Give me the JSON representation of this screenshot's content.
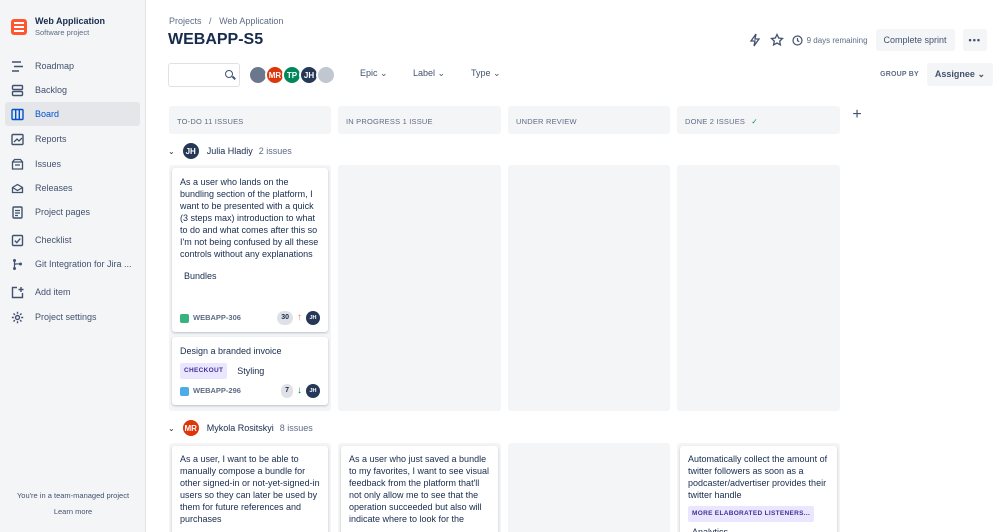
{
  "project": {
    "name": "Web Application",
    "type": "Software project"
  },
  "nav": [
    {
      "label": "Roadmap",
      "icon": "roadmap-icon"
    },
    {
      "label": "Backlog",
      "icon": "backlog-icon"
    },
    {
      "label": "Board",
      "icon": "board-icon",
      "active": true
    },
    {
      "label": "Reports",
      "icon": "reports-icon"
    },
    {
      "label": "Issues",
      "icon": "issues-icon"
    },
    {
      "label": "Releases",
      "icon": "releases-icon"
    },
    {
      "label": "Project pages",
      "icon": "pages-icon"
    },
    {
      "label": "Checklist",
      "icon": "checklist-icon"
    },
    {
      "label": "Git Integration for Jira ...",
      "icon": "git-icon"
    },
    {
      "label": "Add item",
      "icon": "add-item-icon"
    },
    {
      "label": "Project settings",
      "icon": "gear-icon"
    }
  ],
  "footer": {
    "text": "You're in a team-managed project",
    "link": "Learn more"
  },
  "breadcrumbs": {
    "projects": "Projects",
    "sep": "/",
    "current": "Web Application"
  },
  "title": "WEBAPP-S5",
  "header": {
    "days": "9 days remaining",
    "complete": "Complete sprint",
    "more": "•••"
  },
  "toolbar": {
    "avatars": [
      {
        "initials": "",
        "color": "#6b778c"
      },
      {
        "initials": "MR",
        "color": "#de350b"
      },
      {
        "initials": "TP",
        "color": "#00875a"
      },
      {
        "initials": "JH",
        "color": "#253858"
      },
      {
        "initials": "",
        "color": "#c1c7d0"
      }
    ],
    "filters": [
      "Epic",
      "Label",
      "Type"
    ],
    "group_by_label": "GROUP BY",
    "group_by_value": "Assignee"
  },
  "columns": [
    "TO-DO 11 ISSUES",
    "IN PROGRESS 1 ISSUE",
    "UNDER REVIEW",
    "DONE 2 ISSUES"
  ],
  "swimlanes": [
    {
      "initials": "JH",
      "name": "Julia Hladiy",
      "count": "2 issues",
      "color": "#253858"
    },
    {
      "initials": "MR",
      "name": "Mykola Rositskyi",
      "count": "8 issues",
      "color": "#de350b"
    }
  ],
  "cards": {
    "c1": {
      "text": "As a user who lands on the bundling section of the platform, I want to be presented with a quick (3 steps max) introduction to what to do and what comes after this so I'm not being confused by all these controls without any explanations",
      "label": "Bundles",
      "key": "WEBAPP-306",
      "estimate": "30",
      "avatar": "JH",
      "type_color": "#36b37e"
    },
    "c2": {
      "text": "Design a branded invoice",
      "epic": "CHECKOUT",
      "label": "Styling",
      "key": "WEBAPP-296",
      "estimate": "7",
      "avatar": "JH",
      "type_color": "#4bade8"
    },
    "c3": {
      "text": "As a user, I want to be able to manually compose a bundle for other signed-in or not-yet-signed-in users so they can later be used by them for future references and purchases"
    },
    "c4": {
      "text": "As a user who just saved a bundle to my favorites, I want to see visual feedback from the platform that'll not only allow me to see that the operation succeeded but also will indicate where to look for the"
    },
    "c5": {
      "text": "Automatically collect the amount of twitter followers as soon as a podcaster/advertiser provides their twitter handle",
      "epic": "MORE ELABORATED LISTENERS...",
      "label": "Analytics"
    }
  }
}
